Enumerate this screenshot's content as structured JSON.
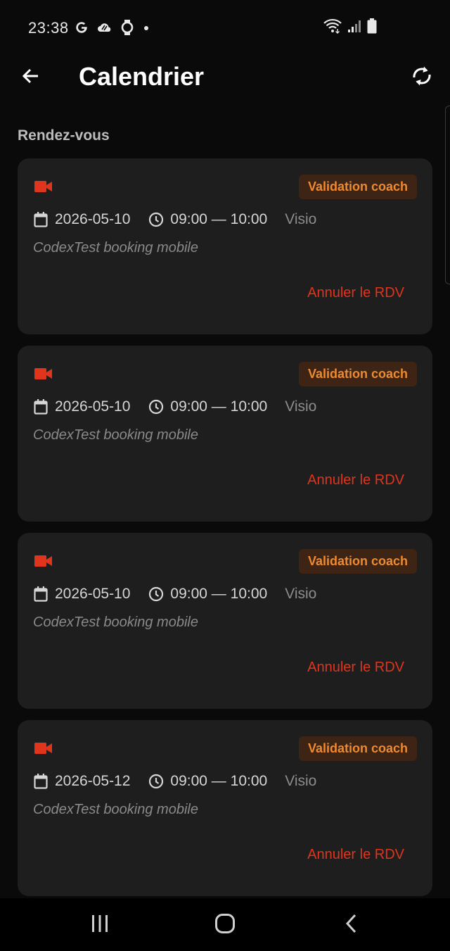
{
  "status_bar": {
    "time": "23:38",
    "left_icons": [
      "google-icon",
      "cloud-icon",
      "watch-icon",
      "dot-icon"
    ],
    "right_icons": [
      "wifi-icon",
      "signal-icon",
      "battery-icon"
    ]
  },
  "header": {
    "title": "Calendrier",
    "back_icon": "arrow-left-icon",
    "refresh_icon": "refresh-icon"
  },
  "section": {
    "title": "Rendez-vous"
  },
  "appointments": [
    {
      "icon": "video-camera-icon",
      "status": "Validation coach",
      "date": "2026-05-10",
      "time": "09:00 — 10:00",
      "mode": "Visio",
      "description": "CodexTest booking mobile",
      "cancel_label": "Annuler le RDV"
    },
    {
      "icon": "video-camera-icon",
      "status": "Validation coach",
      "date": "2026-05-10",
      "time": "09:00 — 10:00",
      "mode": "Visio",
      "description": "CodexTest booking mobile",
      "cancel_label": "Annuler le RDV"
    },
    {
      "icon": "video-camera-icon",
      "status": "Validation coach",
      "date": "2026-05-10",
      "time": "09:00 — 10:00",
      "mode": "Visio",
      "description": "CodexTest booking mobile",
      "cancel_label": "Annuler le RDV"
    },
    {
      "icon": "video-camera-icon",
      "status": "Validation coach",
      "date": "2026-05-12",
      "time": "09:00 — 10:00",
      "mode": "Visio",
      "description": "CodexTest booking mobile",
      "cancel_label": "Annuler le RDV"
    }
  ],
  "nav_bar": {
    "icons": [
      "recent-apps-icon",
      "home-icon",
      "back-icon"
    ]
  },
  "colors": {
    "background": "#0a0a0a",
    "card": "#1e1e1e",
    "accent_red": "#e0341c",
    "badge_bg": "#3d2414",
    "badge_text": "#ee8a30"
  }
}
